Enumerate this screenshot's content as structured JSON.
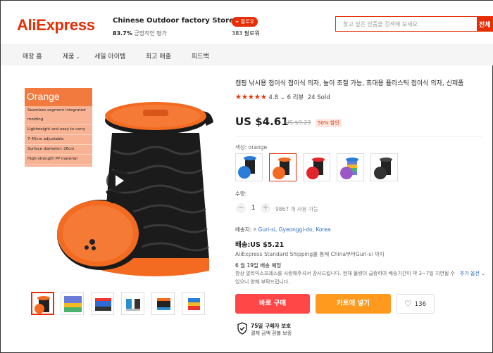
{
  "header": {
    "logo": "AliExpress",
    "store_name": "Chinese Outdoor factory Store",
    "store_arrow": "⌄",
    "store_rating_value": "83.7%",
    "store_rating_text": "긍정적인 평가",
    "follow_label": "+ 팔로우",
    "followers": "383 팔로워",
    "search_placeholder": "찾고 싶은 상품을 검색해 보세요",
    "search_button": "전체"
  },
  "nav": {
    "items": [
      "매장 홈",
      "제품",
      "세일 아이템",
      "최고 매출",
      "피드백"
    ]
  },
  "gallery": {
    "info_card": {
      "title": "Orange",
      "lines": [
        "Seamless segment integrated molding",
        "Lightweight and easy to carry",
        "7-45cm adjustable",
        "Surface diameter: 26cm",
        "High-strength PP material"
      ]
    }
  },
  "product": {
    "title": "캠핑 낚시용 접이식 접이식 의자, 높이 조절 가능, 휴대용 플라스틱 접이식 의자, 신제품",
    "stars": "★★★★★",
    "rating": "4.8",
    "reviews": "6 리뷰",
    "sold": "24 Sold",
    "price": "US $4.61",
    "old_price": "US $9.23",
    "discount": "50% 할인",
    "color_label": "색상:",
    "color_value": "orange",
    "quantity_label": "수량:",
    "quantity": "1",
    "minus": "−",
    "plus": "+",
    "available": "9867 개 사용 가능",
    "ship_to_label": "배송지:",
    "ship_to_location": "Guri-si, Gyeonggi-do, Korea",
    "shipping_cost": "배송:US $5.21",
    "shipping_line": "AliExpress Standard Shipping를 통해 China부터Guri-si 까지",
    "delivery_date": "6 월 19일 배송 예정",
    "notice": "항상 알리익스프레스를 사랑해주셔서 감사드립니다. 현재 물량이 급증하여 배송기간이 약 3~7일 지연될 수 있으니 양해 부탁드립니다.",
    "more_options": "추가 옵션 ⌄",
    "buy_now": "바로 구매",
    "add_to_cart": "카트에 넣기",
    "wishlist_count": "136",
    "guarantee_title": "75일 구매자 보호",
    "guarantee_text": "결제 금액 환불 보증"
  },
  "colors": {
    "brand": "#e62e04",
    "buy": "#ff4747",
    "cart": "#ff9a1f",
    "link": "#2b6ec5",
    "stool_orange": "#f26b21",
    "stool_black": "#1a1a1a"
  }
}
